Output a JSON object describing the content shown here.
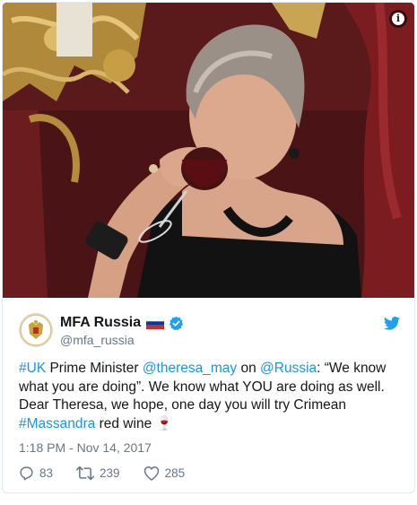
{
  "colors": {
    "link": "#1b95e0",
    "secondary_text": "#657786",
    "primary_text": "#14171a",
    "verified": "#1da1f2",
    "twitter_blue": "#1da1f2"
  },
  "tweet": {
    "display_name": "MFA Russia",
    "handle": "@mfa_russia",
    "flag_icon": "russia-flag-icon",
    "verified_icon": "verified-badge-icon",
    "text": {
      "hashtag_uk": "#UK",
      "part1": " Prime Minister ",
      "mention_may": "@theresa_may",
      "part2": " on ",
      "mention_russia": "@Russia",
      "part3": ": “We know what you are doing”. We know what YOU are doing as well. Dear Theresa, we hope, one day you will try Crimean ",
      "hashtag_massandra": "#Massandra",
      "part4": " red wine ",
      "emoji": "🍷"
    },
    "timestamp": "1:18 PM - Nov 14, 2017",
    "reply_count": "83",
    "retweet_count": "239",
    "like_count": "285"
  },
  "photo": {
    "description_icon": "info-icon"
  }
}
